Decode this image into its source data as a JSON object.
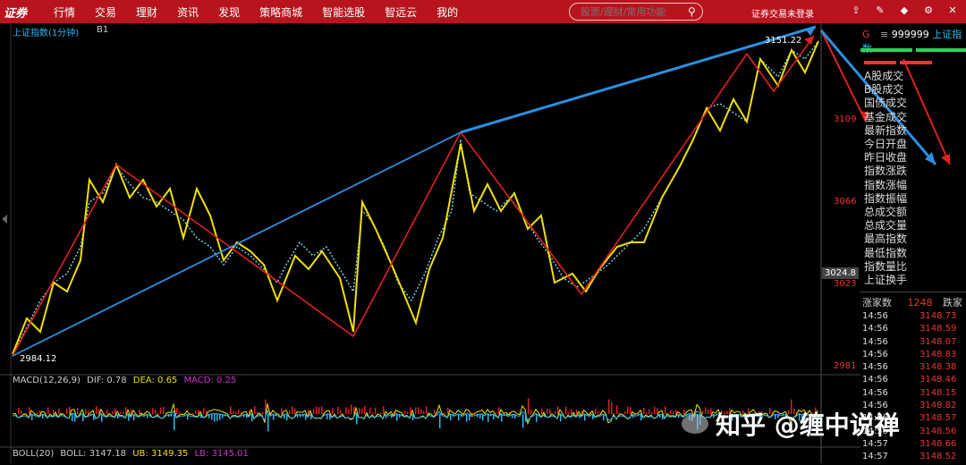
{
  "app": {
    "logo": "证券"
  },
  "nav": [
    "行情",
    "交易",
    "理财",
    "资讯",
    "发现",
    "策略商城",
    "智能选股",
    "智远云",
    "我的"
  ],
  "search": {
    "placeholder": "股票/理财/常用功能"
  },
  "login_status": "证券交易未登录",
  "top_icons": [
    "share-icon",
    "edit-icon",
    "cube-icon",
    "gear-icon",
    "close-icon"
  ],
  "chart": {
    "title": "上证指数(1分钟)",
    "indicator": "B1"
  },
  "price_axis": [
    "3109",
    "3066",
    "3023",
    "2981"
  ],
  "current_price": "3024.8",
  "low_label": "2984.12",
  "high_label": "3151.22",
  "macd": {
    "label": "MACD(12,26,9)",
    "dif_label": "DIF:",
    "dif": "0.78",
    "dea_label": "DEA:",
    "dea": "0.65",
    "macd_label": "MACD:",
    "macd_val": "0.25"
  },
  "boll": {
    "label": "BOLL(20)",
    "boll_label": "BOLL:",
    "boll": "3147.18",
    "ub_label": "UB:",
    "ub": "3149.35",
    "lb_label": "LB:",
    "lb": "3145.01"
  },
  "right_panel": {
    "g_label": "G",
    "code": "999999",
    "name": "上证指数",
    "stats": [
      "A股成交",
      "B股成交",
      "国债成交",
      "基金成交",
      "最新指数",
      "今日开盘",
      "昨日收盘",
      "指数涨跌",
      "指数涨幅",
      "指数振幅",
      "总成交额",
      "总成交量",
      "最高指数",
      "最低指数",
      "指数量比",
      "上证换手"
    ],
    "rise_label": "涨家数",
    "rise_count": "1248",
    "fall_label": "跌家"
  },
  "ticks": [
    {
      "t": "14:56",
      "p": "3148.73"
    },
    {
      "t": "14:56",
      "p": "3148.59"
    },
    {
      "t": "14:56",
      "p": "3148.07"
    },
    {
      "t": "14:56",
      "p": "3148.83"
    },
    {
      "t": "14:56",
      "p": "3148.38"
    },
    {
      "t": "14:56",
      "p": "3148.46"
    },
    {
      "t": "14:56",
      "p": "3148.15"
    },
    {
      "t": "14:56",
      "p": "3148.82"
    },
    {
      "t": "14:56",
      "p": "3148.57"
    },
    {
      "t": "14:56",
      "p": "3148.56"
    },
    {
      "t": "14:57",
      "p": "3148.66"
    },
    {
      "t": "14:57",
      "p": "3148.52"
    }
  ],
  "watermark": "知乎 @缠中说禅",
  "colors": {
    "topbar": "#b8141d",
    "up": "#e33",
    "blue": "#2a8fe0",
    "yellow": "#f0e000"
  }
}
